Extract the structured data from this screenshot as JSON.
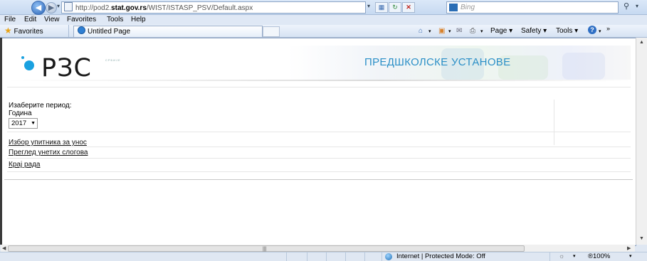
{
  "browser": {
    "url_prefix": "http://pod2.",
    "url_domain": "stat.gov.rs",
    "url_path": "/WIST/ISTASP_PSV/Default.aspx",
    "search_placeholder": "Bing",
    "menu": [
      "File",
      "Edit",
      "View",
      "Favorites",
      "Tools",
      "Help"
    ],
    "favorites_label": "Favorites",
    "tab_title": "Untitled Page",
    "command_bar": {
      "page": "Page ▾",
      "safety": "Safety ▾",
      "tools": "Tools ▾"
    },
    "status": {
      "zone": "Internet | Protected Mode: Off",
      "zoom": "®100%"
    }
  },
  "page": {
    "logo_text": "РЗС",
    "logo_small": "СРБИЈЕ",
    "title": "ПРЕДШКОЛСКЕ УСТАНОВЕ",
    "period_label": "Изаберите период:",
    "year_label": "Година",
    "year_value": "2017",
    "links": {
      "questionnaire": "Избор упитника за унос",
      "review": "Преглед унетих слогова",
      "end": "Крај рада"
    }
  },
  "colors": {
    "title": "#2b8fc7",
    "logo_dot": "#1aa1e0"
  },
  "icons": [
    "back-icon",
    "forward-icon",
    "page-icon",
    "refresh-icon",
    "stop-icon",
    "search-icon",
    "favorites-star-icon",
    "ie-icon",
    "home-icon",
    "feeds-icon",
    "mail-icon",
    "print-icon",
    "help-icon",
    "globe-icon",
    "zoom-icon"
  ]
}
